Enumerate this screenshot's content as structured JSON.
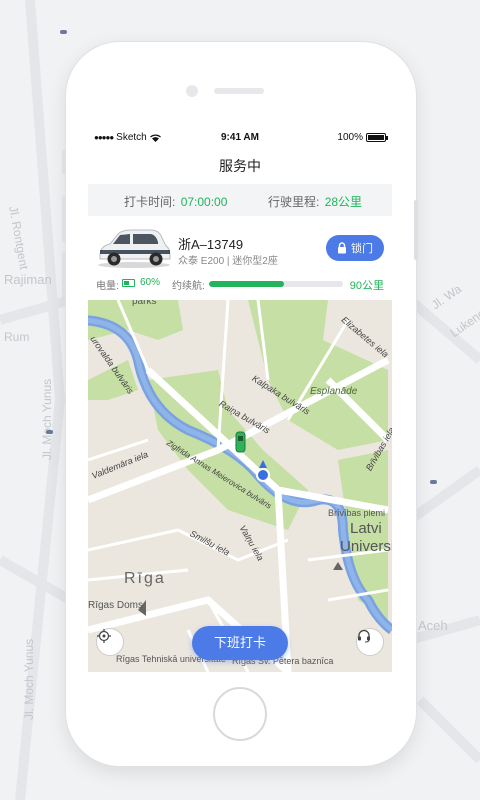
{
  "background_map": {
    "labels": [
      "Rajiman",
      "Rum",
      "Jl. Rontgent",
      "Jl. Moch Yunus",
      "Jl. Moch Yunus",
      "Jl. Wa",
      "Aceh",
      "Lukeno"
    ]
  },
  "status_bar": {
    "carrier": "Sketch",
    "time": "9:41 AM",
    "battery": "100%"
  },
  "nav": {
    "title": "服务中"
  },
  "trip_info": {
    "checkin_label": "打卡时间:",
    "checkin_value": "07:00:00",
    "mileage_label": "行驶里程:",
    "mileage_value": "28公里"
  },
  "car": {
    "plate": "浙A–13749",
    "model": "众泰 E200 | 迷你型2座",
    "lock_label": "锁门",
    "battery_label": "电量:",
    "battery_value": "60%",
    "battery_level": 0.6,
    "range_label": "约续航:",
    "range_value": "90公里",
    "range_fraction": 0.56
  },
  "map": {
    "places": [
      "parks",
      "Esplanāde",
      "Latvi",
      "Universi",
      "Rīga",
      "Rīgas Doms",
      "Rīgas Tehniskā universitāte",
      "Rīgas Sv. Pētera baznīca",
      "Brīvības piemi"
    ],
    "streets": [
      "Elizabetes iela",
      "Kalpaka bulvāris",
      "Raiņa bulvāris",
      "Brīvības iela",
      "Valdemāra iela",
      "Zigfrīda Annas Meierovica bulvāris",
      "Smilšu iela",
      "Valņu iela",
      "urovalda bulvāris"
    ],
    "checkout_label": "下班打卡"
  }
}
